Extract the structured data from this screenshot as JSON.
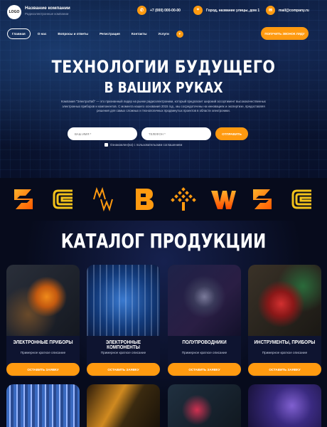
{
  "header": {
    "logo": "LOGO",
    "company_name": "Название компании",
    "company_desc": "Радиоэлектронные компании",
    "phone": "+7 (000) 000-00-00",
    "address": "Город, название улицы, дом 1",
    "email": "mail@company.ru"
  },
  "nav": {
    "items": [
      "Главная",
      "О нас",
      "Вопросы и ответы",
      "Регистрация",
      "Контакты",
      "Услуги"
    ],
    "more_icon": "chevron-down-icon",
    "call_button": "ПОЛУЧИТЬ ЗВОНОК ЛИДУ"
  },
  "hero": {
    "title_line1": "ТЕХНОЛОГИИ БУДУЩЕГО",
    "title_line2": "В ВАШИХ РУКАХ",
    "lead": "Компания \"ЭлектроЛаб\" — это признанный лидер на рынке радиоэлектроники, который предлагает широкий ассортимент высококачественных электронных приборов и компонентов. С момента нашего основания 2015 год , мы сосредоточены на инновациях и экспертизе, предоставляя решения для самых сложных и технологичных продвинутых проектов в области электроники.",
    "name_placeholder": "ВАШ ИМЯ *",
    "phone_placeholder": "ТЕЛЕФОН *",
    "send_button": "ОТПРАВИТЬ",
    "agree_text": "Ознакомлен(на) с пользовательским соглашением"
  },
  "brands": [
    "brand-s-icon",
    "brand-c-icon",
    "brand-mw-icon",
    "brand-b-icon",
    "brand-tree-icon",
    "brand-w-icon",
    "brand-s-icon",
    "brand-c-icon"
  ],
  "catalog": {
    "title": "КАТАЛОГ ПРОДУКЦИИ",
    "cards": [
      {
        "name": "ЭЛЕКТРОННЫЕ ПРИБОРЫ",
        "desc": "Примерное краткое описание",
        "button": "ОСТАВИТЬ ЗАЯВКУ"
      },
      {
        "name": "ЭЛЕКТРОННЫЕ КОМПОНЕНТЫ",
        "desc": "Примерное краткое описание",
        "button": "ОСТАВИТЬ ЗАЯВКУ"
      },
      {
        "name": "ПОЛУПРОВОДНИКИ",
        "desc": "Примерное краткое описание",
        "button": "ОСТАВИТЬ ЗАЯВКУ"
      },
      {
        "name": "ИНСТРУМЕНТЫ, ПРИБОРЫ",
        "desc": "Примерное краткое описание",
        "button": "ОСТАВИТЬ ЗАЯВКУ"
      }
    ]
  },
  "colors": {
    "accent": "#ff9a10",
    "background": "#070b1c"
  }
}
